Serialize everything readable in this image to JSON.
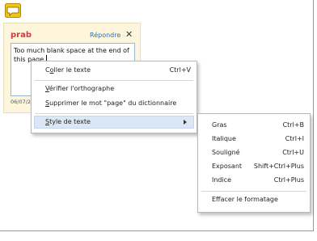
{
  "comment": {
    "author": "prab",
    "reply_label": "Répondre",
    "close_glyph": "✕",
    "text": "Too much blank space at the end of this page.",
    "date": "06/07/20",
    "icon": "comment-bubble-icon",
    "icon_color": "#f2c31a"
  },
  "context_menu": {
    "items": [
      {
        "pre": "C",
        "u": "o",
        "post": "ller le texte",
        "shortcut": "Ctrl+V"
      },
      {
        "pre": "",
        "u": "V",
        "post": "érifier l'orthographe",
        "shortcut": ""
      },
      {
        "pre": "",
        "u": "S",
        "post": "upprimer le mot \"page\" du dictionnaire",
        "shortcut": ""
      },
      {
        "pre": "",
        "u": "S",
        "post": "tyle de texte",
        "shortcut": ""
      }
    ],
    "highlight_color": "#dbe7f4"
  },
  "submenu": {
    "items": [
      {
        "label": "Gras",
        "shortcut": "Ctrl+B"
      },
      {
        "label": "Italique",
        "shortcut": "Ctrl+I"
      },
      {
        "label": "Souligné",
        "shortcut": "Ctrl+U"
      },
      {
        "label": "Exposant",
        "shortcut": "Shift+Ctrl+Plus"
      },
      {
        "label": "Indice",
        "shortcut": "Ctrl+Plus"
      },
      {
        "label": "Effacer le formatage",
        "shortcut": ""
      }
    ]
  }
}
